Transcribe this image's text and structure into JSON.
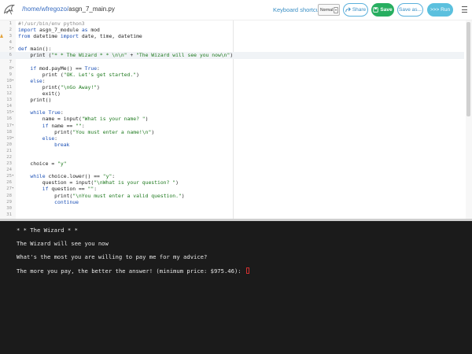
{
  "header": {
    "path_prefix": "/home/wfregozo/",
    "filename": "asgn_7_main.py",
    "keyboard_label": "Keyboard shortcuts:",
    "keyboard_mode": "Normal",
    "share_label": "Share",
    "save_label": "Save",
    "saveas_label": "Save as...",
    "run_label": ">>> Run",
    "icons": [
      "logo-icon",
      "share-icon",
      "save-icon",
      "menu-icon"
    ]
  },
  "editor": {
    "active_line": 6,
    "warning_line": 3,
    "lines": [
      {
        "n": "1",
        "fold": "",
        "segs": [
          [
            "cm",
            "#!/usr/bin/env python3"
          ]
        ]
      },
      {
        "n": "2",
        "fold": "",
        "segs": [
          [
            "kw",
            "import"
          ],
          [
            "",
            " asgn_7_module "
          ],
          [
            "kw",
            "as"
          ],
          [
            "",
            " mod"
          ]
        ]
      },
      {
        "n": "3",
        "fold": "",
        "segs": [
          [
            "kw",
            "from"
          ],
          [
            "",
            " datetime "
          ],
          [
            "kw",
            "import"
          ],
          [
            "",
            " date, time, datetime"
          ]
        ]
      },
      {
        "n": "4",
        "fold": "",
        "segs": []
      },
      {
        "n": "5",
        "fold": "v",
        "segs": [
          [
            "kw",
            "def"
          ],
          [
            "",
            " main():"
          ]
        ]
      },
      {
        "n": "6",
        "fold": "",
        "segs": [
          [
            "",
            "    print ("
          ],
          [
            "str",
            "\"* * The Wizard * * \\n\\n\""
          ],
          [
            "",
            " + "
          ],
          [
            "str",
            "\"The Wizard will see you now\\n\""
          ],
          [
            "",
            ")"
          ]
        ]
      },
      {
        "n": "7",
        "fold": "",
        "segs": []
      },
      {
        "n": "8",
        "fold": "v",
        "segs": [
          [
            "",
            "    "
          ],
          [
            "kw",
            "if"
          ],
          [
            "",
            " mod.payMe() == "
          ],
          [
            "kw",
            "True"
          ],
          [
            "",
            ":"
          ]
        ]
      },
      {
        "n": "9",
        "fold": "",
        "segs": [
          [
            "",
            "        print ("
          ],
          [
            "str",
            "\"OK. Let's get started.\""
          ],
          [
            "",
            ")"
          ]
        ]
      },
      {
        "n": "10",
        "fold": "v",
        "segs": [
          [
            "",
            "    "
          ],
          [
            "kw",
            "else"
          ],
          [
            "",
            ":"
          ]
        ]
      },
      {
        "n": "11",
        "fold": "",
        "segs": [
          [
            "",
            "        print("
          ],
          [
            "str",
            "\"\\nGo Away!\""
          ],
          [
            "",
            ")"
          ]
        ]
      },
      {
        "n": "12",
        "fold": "",
        "segs": [
          [
            "",
            "        exit()"
          ]
        ]
      },
      {
        "n": "13",
        "fold": "",
        "segs": [
          [
            "",
            "    print()"
          ]
        ]
      },
      {
        "n": "14",
        "fold": "",
        "segs": []
      },
      {
        "n": "15",
        "fold": "v",
        "segs": [
          [
            "",
            "    "
          ],
          [
            "kw",
            "while"
          ],
          [
            "",
            " "
          ],
          [
            "kw",
            "True"
          ],
          [
            "",
            ":"
          ]
        ]
      },
      {
        "n": "16",
        "fold": "",
        "segs": [
          [
            "",
            "        name = input("
          ],
          [
            "str",
            "\"What is your name? \""
          ],
          [
            "",
            ")"
          ]
        ]
      },
      {
        "n": "17",
        "fold": "v",
        "segs": [
          [
            "",
            "        "
          ],
          [
            "kw",
            "if"
          ],
          [
            "",
            " name == "
          ],
          [
            "str",
            "\"\""
          ],
          [
            "",
            ":"
          ]
        ]
      },
      {
        "n": "18",
        "fold": "",
        "segs": [
          [
            "",
            "            print("
          ],
          [
            "str",
            "\"You must enter a name!\\n\""
          ],
          [
            "",
            ")"
          ]
        ]
      },
      {
        "n": "19",
        "fold": "v",
        "segs": [
          [
            "",
            "        "
          ],
          [
            "kw",
            "else"
          ],
          [
            "",
            ":"
          ]
        ]
      },
      {
        "n": "20",
        "fold": "",
        "segs": [
          [
            "",
            "            "
          ],
          [
            "kw",
            "break"
          ]
        ]
      },
      {
        "n": "21",
        "fold": "",
        "segs": []
      },
      {
        "n": "22",
        "fold": "",
        "segs": []
      },
      {
        "n": "23",
        "fold": "",
        "segs": [
          [
            "",
            "    choice = "
          ],
          [
            "str",
            "\"y\""
          ]
        ]
      },
      {
        "n": "24",
        "fold": "",
        "segs": []
      },
      {
        "n": "25",
        "fold": "v",
        "segs": [
          [
            "",
            "    "
          ],
          [
            "kw",
            "while"
          ],
          [
            "",
            " choice.lower() == "
          ],
          [
            "str",
            "\"y\""
          ],
          [
            "",
            ":"
          ]
        ]
      },
      {
        "n": "26",
        "fold": "",
        "segs": [
          [
            "",
            "        question = input("
          ],
          [
            "str",
            "\"\\nWhat is your question? \""
          ],
          [
            "",
            ")"
          ]
        ]
      },
      {
        "n": "27",
        "fold": "v",
        "segs": [
          [
            "",
            "        "
          ],
          [
            "kw",
            "if"
          ],
          [
            "",
            " question == "
          ],
          [
            "str",
            "\"\""
          ],
          [
            "",
            ":"
          ]
        ]
      },
      {
        "n": "28",
        "fold": "",
        "segs": [
          [
            "",
            "            print("
          ],
          [
            "str",
            "\"\\nYou must enter a valid question.\""
          ],
          [
            "",
            ")"
          ]
        ]
      },
      {
        "n": "29",
        "fold": "",
        "segs": [
          [
            "",
            "            "
          ],
          [
            "kw",
            "continue"
          ]
        ]
      },
      {
        "n": "30",
        "fold": "",
        "segs": []
      },
      {
        "n": "31",
        "fold": "",
        "segs": []
      }
    ]
  },
  "console": {
    "lines": [
      "* * The Wizard * *",
      "The Wizard will see you now",
      "What's the most you are willing to pay me for my advice?",
      "The more you pay, the better the answer! (minimum price: $975.46): "
    ]
  },
  "colors": {
    "console_bg": "#1b1b1b",
    "save_green": "#27ae60",
    "run_blue": "#5bc0de",
    "link_blue": "#3a6ec2",
    "keyword": "#1a4fb5",
    "string": "#1f7a1f"
  }
}
